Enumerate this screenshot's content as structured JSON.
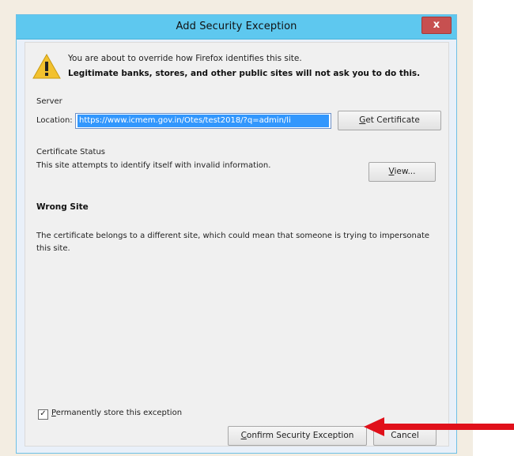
{
  "window": {
    "title": "Add Security Exception",
    "close_label": "x"
  },
  "warning": {
    "line1": "You are about to override how Firefox identifies this site.",
    "line2": "Legitimate banks, stores, and other public sites will not ask you to do this."
  },
  "server": {
    "section_label": "Server",
    "location_label": "Location:",
    "location_value": "https://www.icmem.gov.in/Otes/test2018/?q=admin/li",
    "get_certificate_prefix": "G",
    "get_certificate_rest": "et Certificate"
  },
  "certificate": {
    "section_label": "Certificate Status",
    "status_text": "This site attempts to identify itself with invalid information.",
    "view_prefix": "V",
    "view_rest": "iew...",
    "error_title": "Wrong Site",
    "error_description": "The certificate belongs to a different site, which could mean that someone is trying to impersonate this site."
  },
  "footer": {
    "checkbox_checked": true,
    "checkbox_mark": "✓",
    "checkbox_prefix": "P",
    "checkbox_rest": "ermanently store this exception",
    "confirm_prefix": "C",
    "confirm_rest": "onfirm Security Exception",
    "cancel_label": "Cancel"
  },
  "colors": {
    "titlebar": "#5ec8ef",
    "close": "#c75050",
    "selection": "#3297fd",
    "arrow": "#e0101a"
  }
}
